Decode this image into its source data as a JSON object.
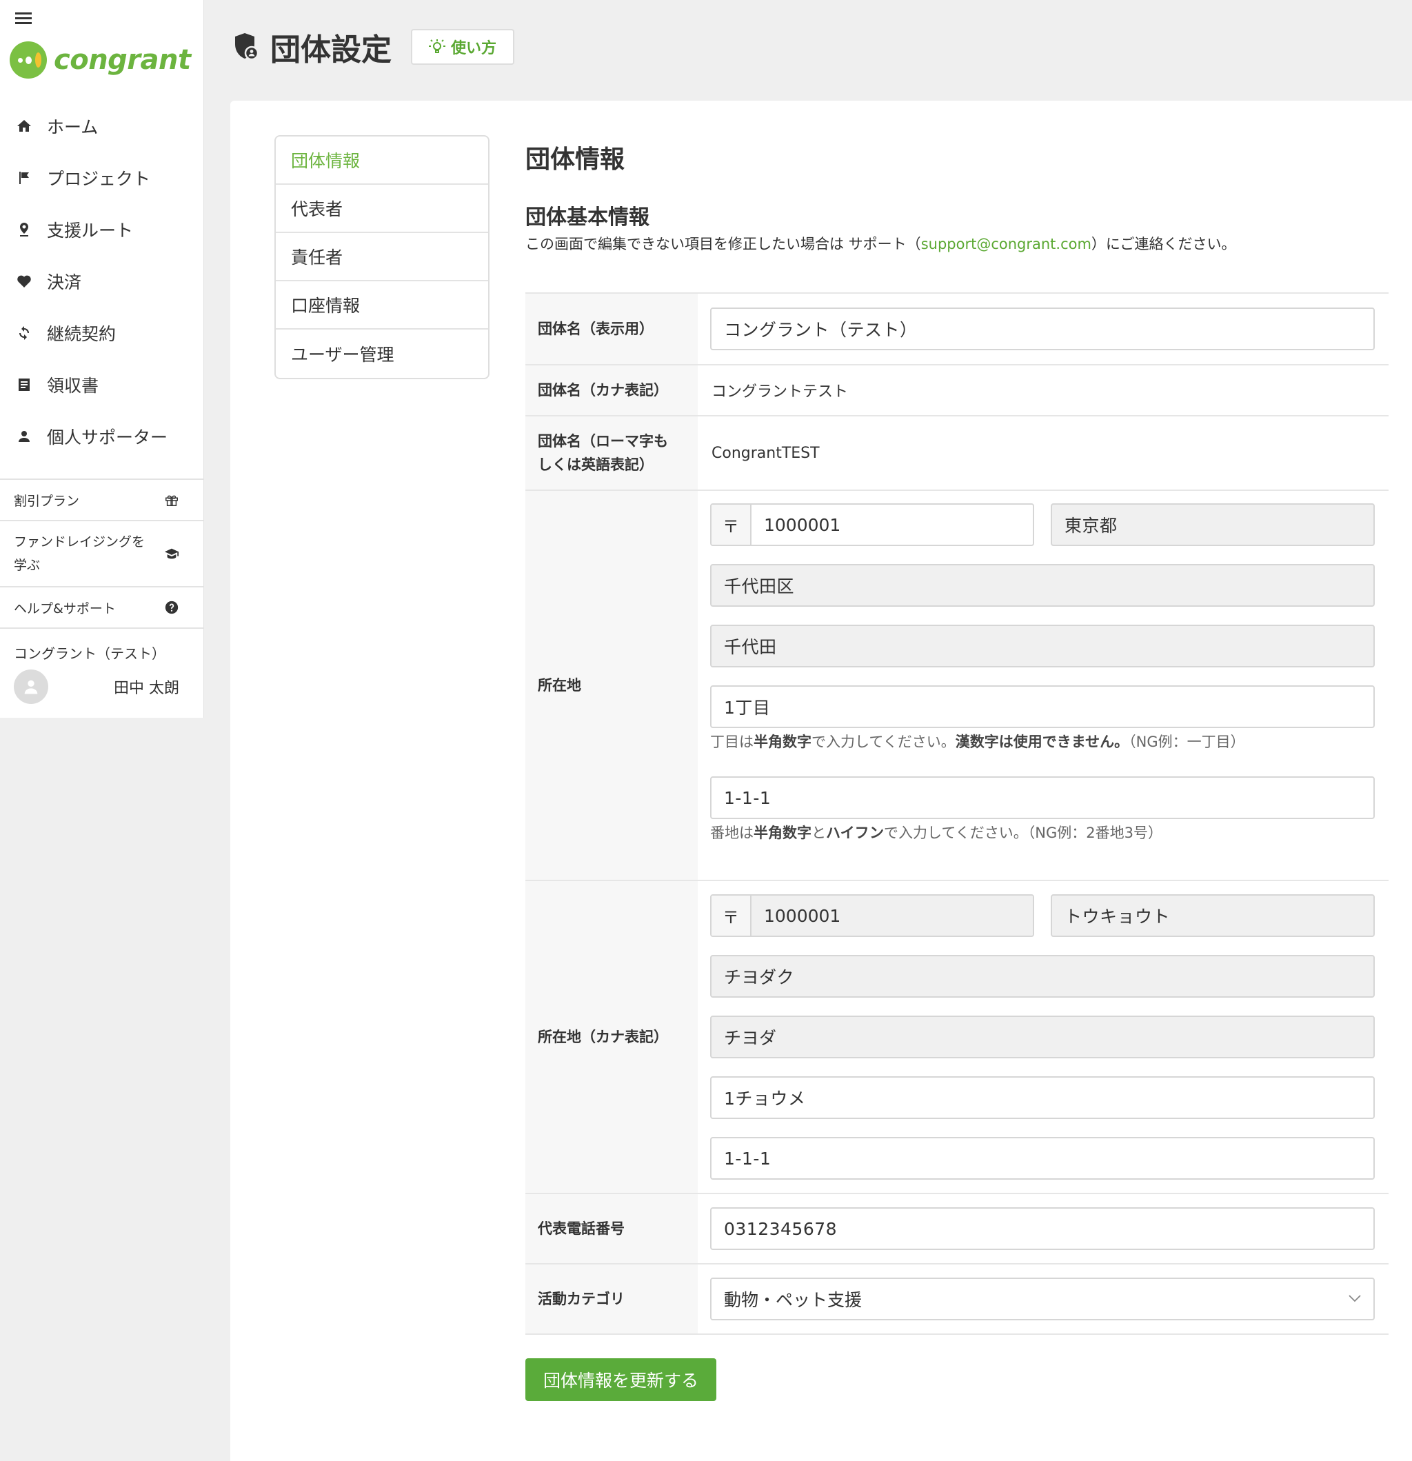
{
  "sidebar": {
    "logo_text": "congrant",
    "nav": [
      {
        "label": "ホーム",
        "icon": "home-icon"
      },
      {
        "label": "プロジェクト",
        "icon": "flag-icon"
      },
      {
        "label": "支援ルート",
        "icon": "location-pin-icon"
      },
      {
        "label": "決済",
        "icon": "heart-icon"
      },
      {
        "label": "継続契約",
        "icon": "refresh-icon"
      },
      {
        "label": "領収書",
        "icon": "receipt-icon"
      },
      {
        "label": "個人サポーター",
        "icon": "person-icon"
      }
    ],
    "links": [
      {
        "label": "割引プラン",
        "icon": "gift-icon"
      },
      {
        "label": "ファンドレイジングを学ぶ",
        "icon": "graduation-cap-icon"
      },
      {
        "label": "ヘルプ&サポート",
        "icon": "help-circle-icon"
      }
    ],
    "org_name": "コングラント（テスト）",
    "user_name": "田中 太朗"
  },
  "header": {
    "title": "団体設定",
    "howto_label": "使い方"
  },
  "subnav": [
    {
      "label": "団体情報",
      "active": true
    },
    {
      "label": "代表者",
      "active": false
    },
    {
      "label": "責任者",
      "active": false
    },
    {
      "label": "口座情報",
      "active": false
    },
    {
      "label": "ユーザー管理",
      "active": false
    }
  ],
  "main": {
    "section_title": "団体情報",
    "sub_title": "団体基本情報",
    "notice_pre": "この画面で編集できない項目を修正したい場合は サポート（",
    "notice_link": "support@congrant.com",
    "notice_post": "）にご連絡ください。",
    "fields": {
      "display_name": {
        "label": "団体名（表示用）",
        "value": "コングラント（テスト）"
      },
      "kana_name": {
        "label": "団体名（カナ表記）",
        "value": "コングラントテスト"
      },
      "roman_name": {
        "label_l1": "団体名（ローマ字も",
        "label_l2": "しくは英語表記）",
        "value": "CongrantTEST"
      },
      "address": {
        "label": "所在地",
        "zip_mark": "〒",
        "zip": "1000001",
        "prefecture": "東京都",
        "city": "千代田区",
        "town": "千代田",
        "chome": "1丁目",
        "chome_hint_1": "丁目は",
        "chome_hint_b1": "半角数字",
        "chome_hint_2": "で入力してください。",
        "chome_hint_b2": "漢数字は使用できません。",
        "chome_hint_3": "（NG例：一丁目）",
        "banchi": "1-1-1",
        "banchi_hint_1": "番地は",
        "banchi_hint_b1": "半角数字",
        "banchi_hint_2": "と",
        "banchi_hint_b2": "ハイフン",
        "banchi_hint_3": "で入力してください。（NG例：2番地3号）"
      },
      "address_kana": {
        "label": "所在地（カナ表記）",
        "zip_mark": "〒",
        "zip": "1000001",
        "prefecture": "トウキョウト",
        "city": "チヨダク",
        "town": "チヨダ",
        "chome": "1チョウメ",
        "banchi": "1-1-1"
      },
      "phone": {
        "label": "代表電話番号",
        "value": "0312345678"
      },
      "category": {
        "label": "活動カテゴリ",
        "value": "動物・ペット支援"
      }
    },
    "submit_label": "団体情報を更新する"
  },
  "colors": {
    "brand_green": "#6cb43f",
    "button_green": "#5aab3a",
    "link_green": "#5aa832"
  }
}
